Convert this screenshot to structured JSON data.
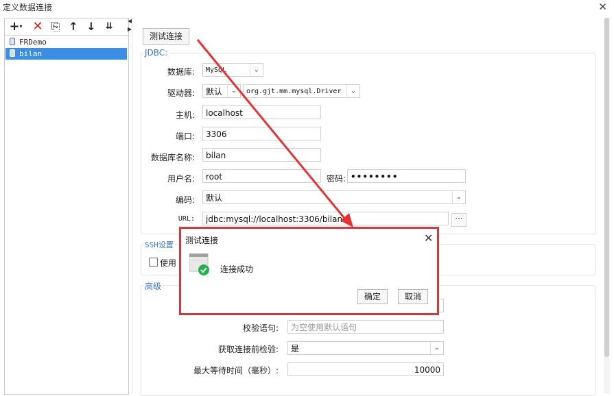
{
  "window": {
    "title": "定义数据连接"
  },
  "toolbar": {
    "add": "+",
    "add_dropdown": "▾",
    "delete": "✕",
    "copy": "⎘",
    "up": "↑",
    "down": "↓",
    "sort": "⇊"
  },
  "connections": [
    {
      "name": "FRDemo",
      "selected": false
    },
    {
      "name": "bilan",
      "selected": true
    }
  ],
  "test_button": "测试连接",
  "jdbc": {
    "legend": "JDBC:",
    "database_label": "数据库:",
    "database_value": "MySQL",
    "driver_label": "驱动器:",
    "driver_mode": "默认",
    "driver_class": "org.gjt.mm.mysql.Driver",
    "host_label": "主机:",
    "host_value": "localhost",
    "port_label": "端口:",
    "port_value": "3306",
    "dbname_label": "数据库名称:",
    "dbname_value": "bilan",
    "user_label": "用户名:",
    "user_value": "root",
    "password_label": "密码:",
    "password_value": "••••••••",
    "encoding_label": "编码:",
    "encoding_value": "默认",
    "url_label": "URL:",
    "url_value": "jdbc:mysql://localhost:3306/bilan",
    "url_button": "···"
  },
  "ssh": {
    "legend": "SSH设置",
    "use_label": "使用"
  },
  "advanced": {
    "legend": "高级",
    "validation_label": "校验语句:",
    "validation_placeholder": "为空使用默认语句",
    "check_label": "获取连接前检验:",
    "check_value": "是",
    "maxwait_label": "最大等待时间（毫秒）:",
    "maxwait_value": "10000"
  },
  "dialog": {
    "title": "测试连接",
    "close": "✕",
    "message": "连接成功",
    "ok": "确定",
    "cancel": "取消"
  },
  "colors": {
    "accent": "#3b79c6",
    "selection": "#3a8ee6",
    "highlight_border": "#e53232",
    "success": "#22b14c"
  }
}
